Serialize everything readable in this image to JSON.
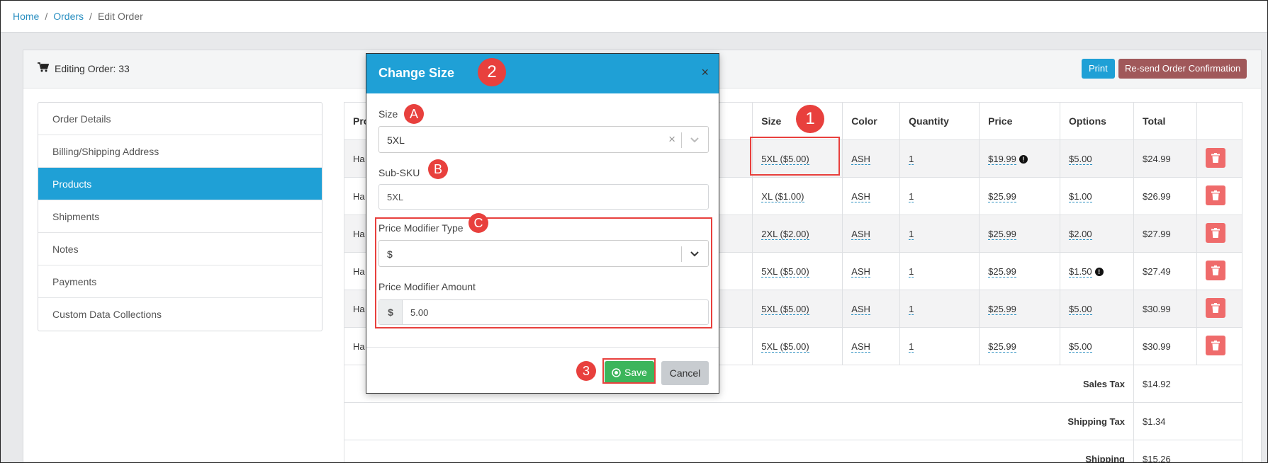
{
  "breadcrumb": {
    "home": "Home",
    "orders": "Orders",
    "current": "Edit Order",
    "separator": "/"
  },
  "header": {
    "title": "Editing Order: 33",
    "print_label": "Print",
    "resend_label": "Re-send Order Confirmation"
  },
  "sidebar": {
    "items": [
      {
        "label": "Order Details"
      },
      {
        "label": "Billing/Shipping Address"
      },
      {
        "label": "Products"
      },
      {
        "label": "Shipments"
      },
      {
        "label": "Notes"
      },
      {
        "label": "Payments"
      },
      {
        "label": "Custom Data Collections"
      }
    ],
    "active_index": 2
  },
  "table": {
    "headers": {
      "product": "Pro",
      "size": "Size",
      "color": "Color",
      "quantity": "Quantity",
      "price": "Price",
      "options": "Options",
      "total": "Total"
    },
    "rows": [
      {
        "product": "Ha",
        "size": "5XL ($5.00)",
        "color": "ASH",
        "quantity": "1",
        "price": "$19.99",
        "price_info": "!",
        "options": "$5.00",
        "total": "$24.99"
      },
      {
        "product": "Ha",
        "size": "XL ($1.00)",
        "color": "ASH",
        "quantity": "1",
        "price": "$25.99",
        "options": "$1.00",
        "total": "$26.99"
      },
      {
        "product": "Ha",
        "size": "2XL ($2.00)",
        "color": "ASH",
        "quantity": "1",
        "price": "$25.99",
        "options": "$2.00",
        "total": "$27.99"
      },
      {
        "product": "Ha",
        "size": "5XL ($5.00)",
        "color": "ASH",
        "quantity": "1",
        "price": "$25.99",
        "options": "$1.50",
        "options_info": "!",
        "total": "$27.49"
      },
      {
        "product": "Ha",
        "size": "5XL ($5.00)",
        "color": "ASH",
        "quantity": "1",
        "price": "$25.99",
        "options": "$5.00",
        "total": "$30.99"
      },
      {
        "product": "Ha",
        "size": "5XL ($5.00)",
        "color": "ASH",
        "quantity": "1",
        "price": "$25.99",
        "options": "$5.00",
        "total": "$30.99"
      }
    ],
    "summary": {
      "sales_tax_label": "Sales Tax",
      "sales_tax": "$14.92",
      "shipping_tax_label": "Shipping Tax",
      "shipping_tax": "$1.34",
      "shipping_label": "Shipping",
      "shipping": "$15.26"
    }
  },
  "modal": {
    "title": "Change Size",
    "close": "×",
    "size_label": "Size",
    "size_value": "5XL",
    "subsku_label": "Sub-SKU",
    "subsku_value": "5XL",
    "modifier_type_label": "Price Modifier Type",
    "modifier_type_value": "$",
    "modifier_amount_label": "Price Modifier Amount",
    "modifier_amount_addon": "$",
    "modifier_amount_value": "5.00",
    "save_label": "Save",
    "cancel_label": "Cancel"
  },
  "callouts": {
    "one": "1",
    "two": "2",
    "three": "3",
    "a": "A",
    "b": "B",
    "c": "C"
  },
  "colors": {
    "primary": "#1fa0d6",
    "danger": "#ef6b6b",
    "success": "#3cb55b",
    "resend": "#a0585a",
    "callout": "#e8403d"
  }
}
